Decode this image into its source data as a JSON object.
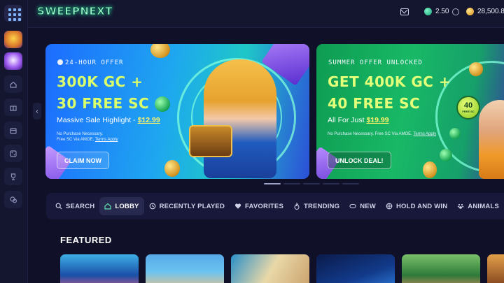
{
  "app": {
    "logo_text": "SWEEPNEXT"
  },
  "header": {
    "sc_balance": "2.50",
    "gc_balance": "28,500.8",
    "icons": [
      "menu-grid-icon",
      "mail-icon",
      "sc-coin-icon",
      "swap-icon",
      "gc-coin-icon"
    ]
  },
  "sidebar": {
    "items": [
      {
        "icon": "game-thumb-1"
      },
      {
        "icon": "game-thumb-2"
      },
      {
        "icon": "home-icon"
      },
      {
        "icon": "gift-icon"
      },
      {
        "icon": "wallet-icon"
      },
      {
        "icon": "dice-icon"
      },
      {
        "icon": "trophy-icon"
      },
      {
        "icon": "chat-icon"
      }
    ]
  },
  "banners": [
    {
      "eyebrow": "24-HOUR OFFER",
      "headline_1": "300K GC +",
      "headline_2": "30 FREE SC",
      "subline": "Massive Sale Highlight -",
      "price": "$12.99",
      "fine_1": "No Purchase Necessary.",
      "fine_2": "Free SC Via AMOE.",
      "terms": "Terms Apply",
      "cta": "CLAIM NOW"
    },
    {
      "eyebrow": "SUMMER OFFER UNLOCKED",
      "headline_1": "GET 400K GC +",
      "headline_2": "40 FREE SC",
      "subline": "All For Just",
      "price": "$19.99",
      "fine_1": "No Purchase Necessary. Free SC Via AMOE.",
      "terms": "Terms Apply",
      "cta": "UNLOCK DEAL!",
      "badge_number": "40",
      "badge_text": "FREE SC"
    }
  ],
  "tabs": [
    {
      "label": "SEARCH",
      "icon": "search-icon",
      "active": false
    },
    {
      "label": "LOBBY",
      "icon": "home-icon",
      "active": true
    },
    {
      "label": "RECENTLY PLAYED",
      "icon": "history-icon",
      "active": false
    },
    {
      "label": "FAVORITES",
      "icon": "heart-icon",
      "active": false
    },
    {
      "label": "TRENDING",
      "icon": "trending-icon",
      "active": false
    },
    {
      "label": "NEW",
      "icon": "new-icon",
      "active": false
    },
    {
      "label": "HOLD AND WIN",
      "icon": "hold-win-icon",
      "active": false
    },
    {
      "label": "ANIMALS",
      "icon": "paw-icon",
      "active": false
    }
  ],
  "featured": {
    "title": "FEATURED"
  },
  "colors": {
    "background": "#101129",
    "accent_lime": "#d9ff6a",
    "active_tab": "#27294f"
  }
}
